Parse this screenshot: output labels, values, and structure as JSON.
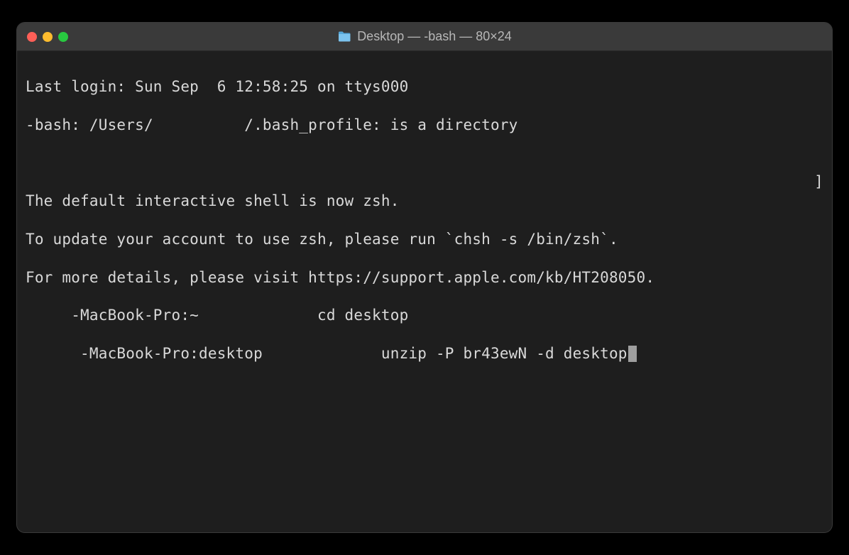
{
  "window": {
    "title": "Desktop — -bash — 80×24"
  },
  "terminal": {
    "lines": [
      "Last login: Sun Sep  6 12:58:25 on ttys000",
      "-bash: /Users/          /.bash_profile: is a directory",
      "",
      "The default interactive shell is now zsh.",
      "To update your account to use zsh, please run `chsh -s /bin/zsh`.",
      "For more details, please visit https://support.apple.com/kb/HT208050.",
      "     -MacBook-Pro:~             cd desktop",
      "      -MacBook-Pro:desktop             unzip -P br43ewN -d desktop"
    ],
    "right_bracket": "]"
  }
}
